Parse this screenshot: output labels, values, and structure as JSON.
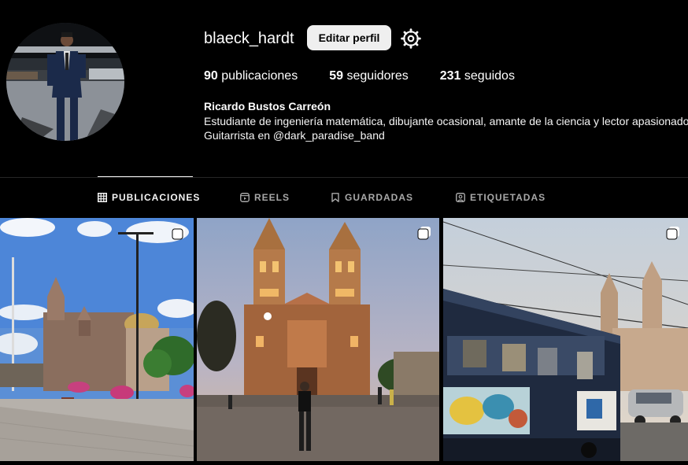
{
  "profile": {
    "username": "blaeck_hardt",
    "edit_label": "Editar perfil",
    "settings_icon": "gear-icon",
    "stats": {
      "posts_count": "90",
      "posts_label": "publicaciones",
      "followers_count": "59",
      "followers_label": "seguidores",
      "following_count": "231",
      "following_label": "seguidos"
    },
    "full_name": "Ricardo Bustos Carreón",
    "bio": [
      "Estudiante de ingeniería matemática, dibujante ocasional, amante de la ciencia y lector apasionado.",
      "Guitarrista en @dark_paradise_band"
    ]
  },
  "tabs": [
    {
      "label": "PUBLICACIONES",
      "icon": "grid-icon",
      "active": true
    },
    {
      "label": "REELS",
      "icon": "reels-icon",
      "active": false
    },
    {
      "label": "GUARDADAS",
      "icon": "bookmark-icon",
      "active": false
    },
    {
      "label": "ETIQUETADAS",
      "icon": "tagged-icon",
      "active": false
    }
  ],
  "posts": [
    {
      "icon": "multiple-images-icon"
    },
    {
      "icon": "multiple-images-icon"
    },
    {
      "icon": "multiple-images-icon"
    }
  ],
  "colors": {
    "background": "#000000",
    "button": "#efefef",
    "muted": "#a8a8a8",
    "divider": "#262626"
  }
}
